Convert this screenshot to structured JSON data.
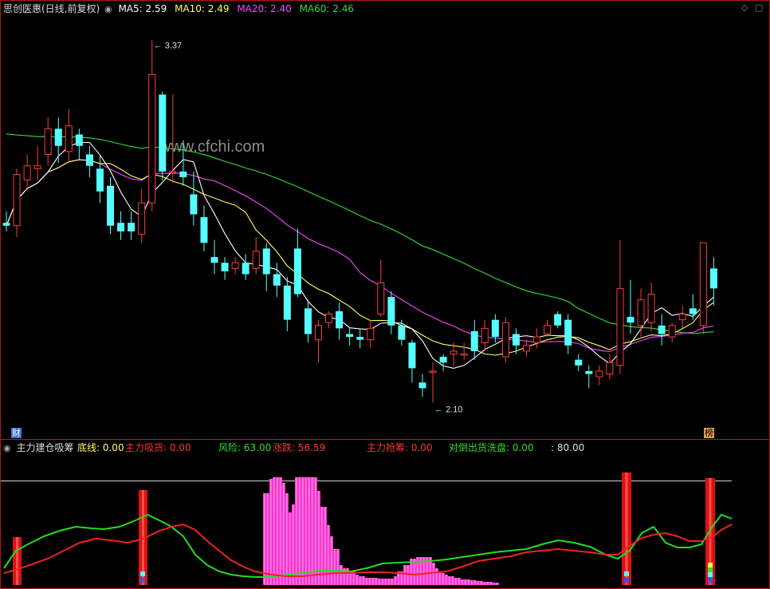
{
  "title": "思创医惠(日线,前复权)",
  "ma_legend": [
    {
      "label": "MA5: 2.59",
      "color": "#ffffff"
    },
    {
      "label": "MA10: 2.49",
      "color": "#ffff66"
    },
    {
      "label": "MA20: 2.40",
      "color": "#ff44ff"
    },
    {
      "label": "MA60: 2.46",
      "color": "#33dd33"
    }
  ],
  "annotations": {
    "high": "3.37",
    "low": "2.10"
  },
  "watermark": "www.cfchi.com",
  "bottom_left_tag": "财",
  "bottom_right_tag": "榜",
  "indicator": {
    "name": "主力建仓吸筹",
    "items": [
      {
        "label": "底线: 0.00",
        "color": "#ffff66"
      },
      {
        "label": "主力吸货: 0.00",
        "color": "#ff3333"
      },
      {
        "label": "风险: 63.00",
        "color": "#33dd33"
      },
      {
        "label": "涨跌: 56.59",
        "color": "#ff3333"
      },
      {
        "label": "主力抢筹: 0.00",
        "color": "#ff3333"
      },
      {
        "label": "对倒出货洗盘: 0.00",
        "color": "#33dd33"
      },
      {
        "label": ": 80.00",
        "color": "#dddddd"
      }
    ]
  },
  "colors": {
    "up": "#ff3b3b",
    "down": "#55ffff",
    "ma5": "#ffffff",
    "ma10": "#ffff66",
    "ma20": "#ff44ff",
    "ma60": "#33dd33",
    "bg": "#000000"
  },
  "chart_data": {
    "type": "candlestick",
    "price_range": [
      2.0,
      3.45
    ],
    "candles": [
      [
        2.73,
        2.72,
        2.7,
        2.77
      ],
      [
        2.72,
        2.9,
        2.68,
        2.92
      ],
      [
        2.88,
        2.93,
        2.85,
        2.97
      ],
      [
        2.92,
        2.93,
        2.88,
        3.0
      ],
      [
        2.97,
        3.06,
        2.93,
        3.1
      ],
      [
        3.06,
        3.0,
        2.94,
        3.1
      ],
      [
        2.98,
        3.07,
        2.94,
        3.13
      ],
      [
        3.04,
        3.0,
        2.95,
        3.06
      ],
      [
        2.97,
        2.93,
        2.89,
        3.0
      ],
      [
        2.92,
        2.84,
        2.8,
        2.97
      ],
      [
        2.86,
        2.72,
        2.69,
        2.89
      ],
      [
        2.73,
        2.7,
        2.67,
        2.77
      ],
      [
        2.73,
        2.7,
        2.67,
        2.77
      ],
      [
        2.69,
        2.8,
        2.66,
        2.85
      ],
      [
        2.8,
        3.25,
        2.77,
        3.37
      ],
      [
        3.18,
        2.91,
        2.88,
        3.19
      ],
      [
        2.91,
        2.91,
        2.87,
        3.18
      ],
      [
        2.91,
        2.89,
        2.86,
        3.02
      ],
      [
        2.83,
        2.76,
        2.72,
        2.91
      ],
      [
        2.75,
        2.66,
        2.63,
        2.79
      ],
      [
        2.61,
        2.59,
        2.55,
        2.67
      ],
      [
        2.59,
        2.56,
        2.53,
        2.61
      ],
      [
        2.57,
        2.59,
        2.55,
        2.61
      ],
      [
        2.59,
        2.55,
        2.53,
        2.62
      ],
      [
        2.57,
        2.63,
        2.55,
        2.68
      ],
      [
        2.64,
        2.55,
        2.49,
        2.66
      ],
      [
        2.55,
        2.51,
        2.47,
        2.59
      ],
      [
        2.51,
        2.39,
        2.35,
        2.54
      ],
      [
        2.64,
        2.48,
        2.47,
        2.71
      ],
      [
        2.43,
        2.34,
        2.31,
        2.46
      ],
      [
        2.32,
        2.37,
        2.24,
        2.39
      ],
      [
        2.38,
        2.41,
        2.36,
        2.42
      ],
      [
        2.42,
        2.36,
        2.32,
        2.45
      ],
      [
        2.34,
        2.33,
        2.3,
        2.36
      ],
      [
        2.33,
        2.32,
        2.29,
        2.36
      ],
      [
        2.32,
        2.36,
        2.29,
        2.39
      ],
      [
        2.41,
        2.52,
        2.4,
        2.6
      ],
      [
        2.47,
        2.37,
        2.34,
        2.49
      ],
      [
        2.37,
        2.32,
        2.3,
        2.39
      ],
      [
        2.31,
        2.22,
        2.17,
        2.32
      ],
      [
        2.17,
        2.15,
        2.12,
        2.2
      ],
      [
        2.21,
        2.21,
        2.1,
        2.24
      ],
      [
        2.26,
        2.24,
        2.21,
        2.27
      ],
      [
        2.27,
        2.28,
        2.23,
        2.31
      ],
      [
        2.27,
        2.27,
        2.25,
        2.31
      ],
      [
        2.35,
        2.28,
        2.25,
        2.39
      ],
      [
        2.31,
        2.36,
        2.28,
        2.39
      ],
      [
        2.39,
        2.33,
        2.31,
        2.41
      ],
      [
        2.26,
        2.38,
        2.24,
        2.4
      ],
      [
        2.34,
        2.3,
        2.27,
        2.36
      ],
      [
        2.28,
        2.3,
        2.26,
        2.32
      ],
      [
        2.31,
        2.33,
        2.29,
        2.36
      ],
      [
        2.34,
        2.37,
        2.33,
        2.39
      ],
      [
        2.41,
        2.37,
        2.36,
        2.42
      ],
      [
        2.39,
        2.3,
        2.27,
        2.41
      ],
      [
        2.25,
        2.23,
        2.21,
        2.27
      ],
      [
        2.21,
        2.2,
        2.15,
        2.23
      ],
      [
        2.19,
        2.21,
        2.16,
        2.23
      ],
      [
        2.2,
        2.24,
        2.18,
        2.27
      ],
      [
        2.23,
        2.5,
        2.2,
        2.67
      ],
      [
        2.4,
        2.38,
        2.34,
        2.53
      ],
      [
        2.37,
        2.46,
        2.33,
        2.5
      ],
      [
        2.38,
        2.48,
        2.35,
        2.52
      ],
      [
        2.37,
        2.34,
        2.3,
        2.41
      ],
      [
        2.33,
        2.37,
        2.31,
        2.38
      ],
      [
        2.39,
        2.41,
        2.36,
        2.44
      ],
      [
        2.43,
        2.41,
        2.39,
        2.48
      ],
      [
        2.37,
        2.66,
        2.34,
        2.66
      ],
      [
        2.57,
        2.5,
        2.44,
        2.61
      ]
    ],
    "indicator": {
      "range": [
        0,
        100
      ],
      "level_line": 80,
      "volume_bars": [
        0,
        0,
        0,
        0,
        0,
        0,
        0,
        0,
        0,
        0,
        0,
        0,
        0,
        0,
        0,
        0,
        0,
        0,
        0,
        0,
        0,
        0,
        0,
        0,
        0,
        0,
        0,
        0,
        0,
        0,
        0,
        0,
        0,
        0,
        0,
        0,
        0,
        0,
        0,
        0,
        0,
        0,
        0,
        0,
        0,
        0,
        0,
        0,
        0,
        0,
        0,
        0,
        0,
        0,
        0,
        0,
        0,
        0,
        0,
        0,
        0,
        0,
        0,
        0,
        0,
        0,
        0,
        0,
        0
      ]
    }
  }
}
